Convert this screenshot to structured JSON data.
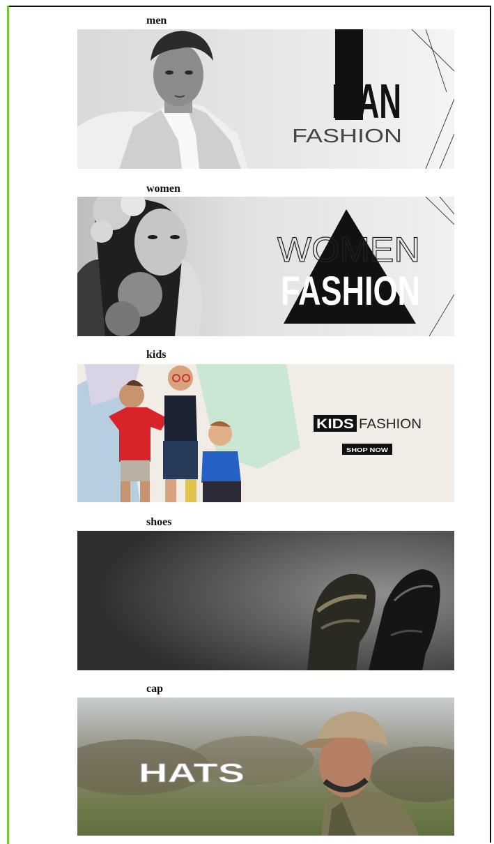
{
  "categories": [
    {
      "label": "men",
      "banner_word_1": "MAN",
      "banner_word_2": "FASHION"
    },
    {
      "label": "women",
      "banner_word_1": "WOMEN",
      "banner_word_2": "FASHION"
    },
    {
      "label": "kids",
      "banner_word_1": "KIDS",
      "banner_word_2": "FASHION",
      "cta": "SHOP NOW"
    },
    {
      "label": "shoes"
    },
    {
      "label": "cap",
      "banner_word_1": "HATS"
    }
  ]
}
